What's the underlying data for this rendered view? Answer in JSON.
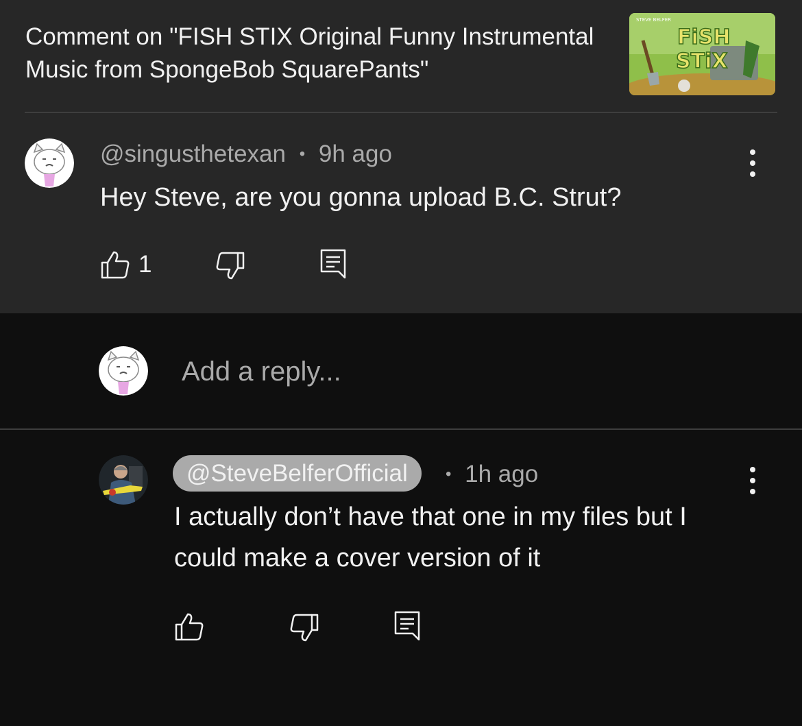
{
  "header": {
    "title": "Comment on \"FISH STIX Original Funny Instrumental Music from SpongeBob SquarePants\"",
    "thumbnail": {
      "title_line1": "FiSH",
      "title_line2": "STiX",
      "channel_text": "STEVE BELFER"
    }
  },
  "comment": {
    "author": "@singusthetexan",
    "separator": "•",
    "time": "9h ago",
    "text": "Hey Steve, are you gonna upload B.C. Strut?",
    "like_count": "1",
    "icons": [
      "like-icon",
      "dislike-icon",
      "reply-icon",
      "more-vertical-icon"
    ]
  },
  "reply_box": {
    "placeholder": "Add a reply..."
  },
  "reply": {
    "author": "@SteveBelferOfficial",
    "separator": "•",
    "time": "1h ago",
    "text": "I actually don’t have that one in my files but I could make a cover version of it",
    "icons": [
      "like-icon",
      "dislike-icon",
      "reply-icon",
      "more-vertical-icon"
    ]
  },
  "colors": {
    "panel": "#272727",
    "background": "#0f0f0f",
    "text_primary": "#f1f1f1",
    "text_secondary": "#aaaaaa",
    "owner_badge": "#aaaaaa",
    "thumbnail_title": "#e8e36b"
  }
}
